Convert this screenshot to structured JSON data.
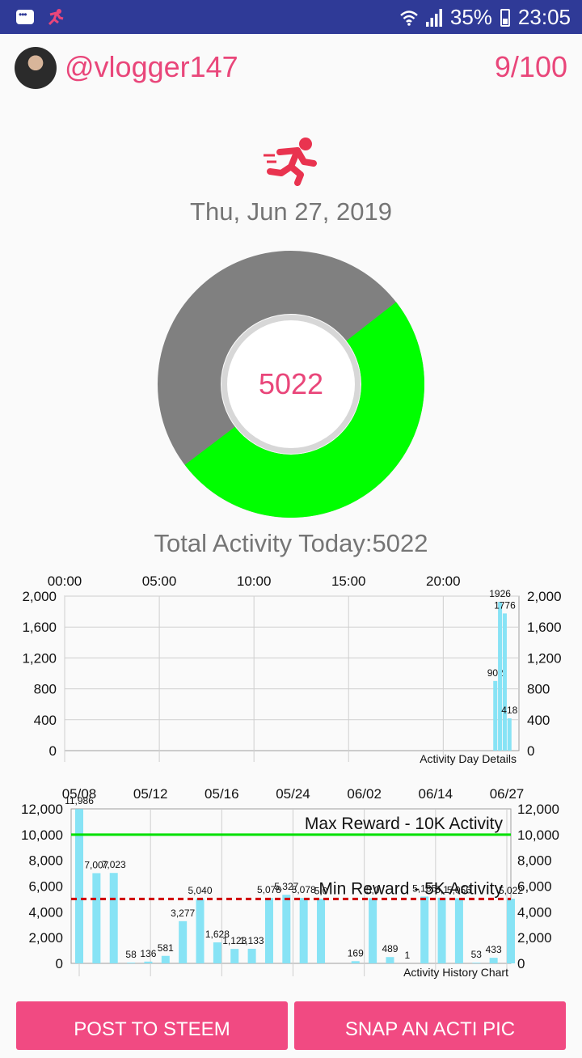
{
  "status_bar": {
    "battery": "35%",
    "time": "23:05"
  },
  "header": {
    "username": "@vlogger147",
    "counter": "9/100"
  },
  "date": "Thu, Jun 27, 2019",
  "donut": {
    "value": "5022",
    "progress_fraction": 0.5022,
    "progress_color": "#00ff00",
    "remaining_color": "#808080"
  },
  "total_text": "Total Activity Today:5022",
  "day_chart": {
    "type": "bar",
    "x_tick_labels": [
      "00:00",
      "05:00",
      "10:00",
      "15:00",
      "20:00"
    ],
    "y_ticks": [
      0,
      400,
      800,
      1200,
      1600,
      2000
    ],
    "y_tick_labels": [
      "0",
      "400",
      "800",
      "1,200",
      "1,600",
      "2,000"
    ],
    "description": "Activity Day Details",
    "bars": [
      {
        "hour": 22.75,
        "value": 902,
        "label": "902"
      },
      {
        "hour": 23.0,
        "value": 1926,
        "label": "1926"
      },
      {
        "hour": 23.25,
        "value": 1776,
        "label": "1776"
      },
      {
        "hour": 23.5,
        "value": 418,
        "label": "418"
      }
    ],
    "ylim": [
      0,
      2000
    ],
    "bar_color": "#87e3f5"
  },
  "history_chart": {
    "type": "bar",
    "x_tick_labels": [
      "05/08",
      "05/12",
      "05/16",
      "05/24",
      "06/02",
      "06/14",
      "06/27"
    ],
    "y_ticks": [
      0,
      2000,
      4000,
      6000,
      8000,
      10000,
      12000
    ],
    "y_tick_labels": [
      "0",
      "2,000",
      "4,000",
      "6,000",
      "8,000",
      "10,000",
      "12,000"
    ],
    "description": "Activity History Chart",
    "max_line": {
      "value": 10000,
      "label": "Max Reward - 10K Activity",
      "color": "#00e000"
    },
    "min_line": {
      "value": 5000,
      "label": "Min Reward - 5K Activity",
      "color": "#d00000"
    },
    "bars": [
      {
        "value": 11986,
        "label": "11,986"
      },
      {
        "value": 7007,
        "label": "7,007"
      },
      {
        "value": 7023,
        "label": "7,023"
      },
      {
        "value": 58,
        "label": "58"
      },
      {
        "value": 136,
        "label": "136"
      },
      {
        "value": 581,
        "label": "581"
      },
      {
        "value": 3277,
        "label": "3,277"
      },
      {
        "value": 5040,
        "label": "5,040"
      },
      {
        "value": 1628,
        "label": "1,628"
      },
      {
        "value": 1123,
        "label": "1,123"
      },
      {
        "value": 1133,
        "label": "1,133"
      },
      {
        "value": 5078,
        "label": "5,078"
      },
      {
        "value": 5327,
        "label": "5,327"
      },
      {
        "value": 5078,
        "label": "5,078"
      },
      {
        "value": 5010,
        "label": "5,0"
      },
      {
        "value": 0,
        "label": ""
      },
      {
        "value": 169,
        "label": "169"
      },
      {
        "value": 5060,
        "label": "5,0"
      },
      {
        "value": 489,
        "label": "489"
      },
      {
        "value": 1,
        "label": "1"
      },
      {
        "value": 5185,
        "label": "5,185"
      },
      {
        "value": 5100,
        "label": "5,1"
      },
      {
        "value": 5056,
        "label": "5,056"
      },
      {
        "value": 53,
        "label": "53"
      },
      {
        "value": 433,
        "label": "433"
      },
      {
        "value": 5022,
        "label": "5,022"
      }
    ],
    "ylim": [
      0,
      12000
    ],
    "bar_color": "#87e3f5"
  },
  "buttons": {
    "post": "POST TO STEEM",
    "snap": "SNAP AN ACTI PIC"
  }
}
